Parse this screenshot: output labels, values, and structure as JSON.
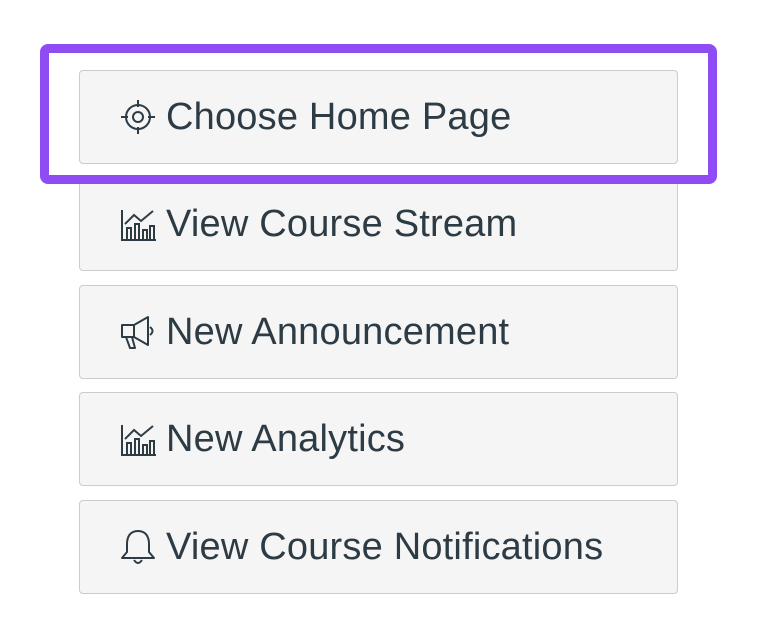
{
  "course_home_actions": {
    "buttons": [
      {
        "label": "Choose Home Page",
        "icon": "target-icon"
      },
      {
        "label": "View Course Stream",
        "icon": "analytics-icon"
      },
      {
        "label": "New Announcement",
        "icon": "megaphone-icon"
      },
      {
        "label": "New Analytics",
        "icon": "analytics-icon"
      },
      {
        "label": "View Course Notifications",
        "icon": "bell-icon"
      }
    ],
    "highlight": {
      "target_index": 0,
      "color": "#8f4cf5"
    },
    "colors": {
      "button_background": "#f5f5f5",
      "button_border": "#c7cdd1",
      "text": "#2d3b45"
    }
  }
}
